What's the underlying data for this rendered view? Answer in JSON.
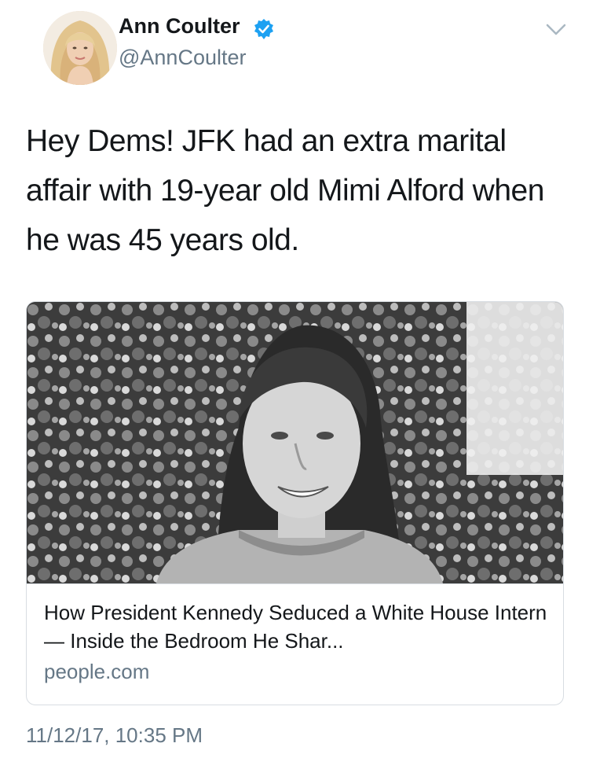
{
  "tweet": {
    "author": {
      "display_name": "Ann Coulter",
      "handle": "@AnnCoulter",
      "verified": true,
      "avatar_icon": "profile-photo",
      "verified_icon": "verified-badge-icon"
    },
    "menu_icon": "chevron-down-icon",
    "text": "Hey Dems!  JFK had an extra marital affair with 19-year old Mimi Alford when he was 45 years old.",
    "link_card": {
      "image_icon": "article-photo",
      "title": "How President Kennedy Seduced a White House Intern — Inside the Bedroom He Shar...",
      "domain": "people.com"
    },
    "timestamp": "11/12/17, 10:35 PM"
  },
  "colors": {
    "text_primary": "#14171a",
    "text_secondary": "#657786",
    "verified_blue": "#1da1f2",
    "card_border": "#d8dde2"
  }
}
